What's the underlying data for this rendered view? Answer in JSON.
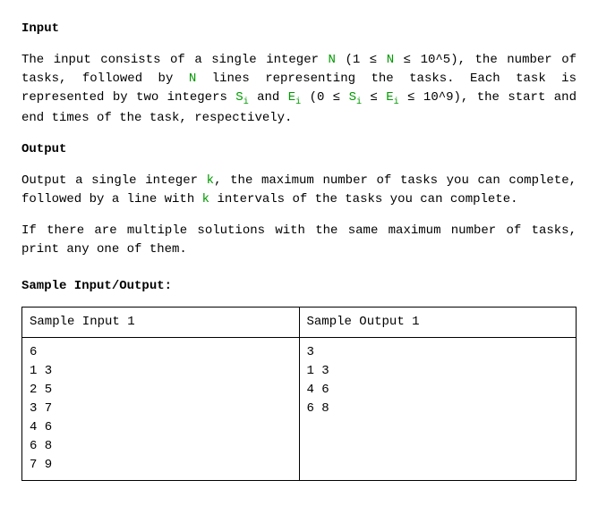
{
  "sections": {
    "input_heading": "Input",
    "input_para_pre_N": "The input consists of a single integer ",
    "var_N": "N",
    "input_para_after_N": " (1 ≤ ",
    "var_N2": "N",
    "input_para_bound_N": " ≤ 10^5), the number of tasks, followed by ",
    "var_N3": "N",
    "input_para_lines": " lines representing the tasks. Each task is represented by two integers ",
    "var_S": "S",
    "sub_i1": "i",
    "and_txt": " and ",
    "var_E": "E",
    "sub_i2": "i",
    "input_para_bounds2_a": " (0 ≤ ",
    "var_S2": "S",
    "sub_i3": "i",
    "leq1": " ≤ ",
    "var_E2": "E",
    "sub_i4": "i",
    "input_para_bounds2_b": " ≤ 10^9), the start and end times of the task, respectively.",
    "output_heading": "Output",
    "output_para_pre_k": "Output a single integer ",
    "var_k": "k",
    "output_para_mid": ", the maximum number of tasks you can complete, followed by a line with ",
    "var_k2": "k",
    "output_para_end": " intervals of the tasks you can complete.",
    "output_para2": "If there are multiple solutions with the same maximum number of tasks, print any one of them.",
    "sample_heading": "Sample Input/Output:"
  },
  "sample_table": {
    "header_input": "Sample Input 1",
    "header_output": "Sample Output 1",
    "input_text": "6\n1 3\n2 5\n3 7\n4 6\n6 8\n7 9",
    "output_text": "3\n1 3\n4 6\n6 8"
  }
}
